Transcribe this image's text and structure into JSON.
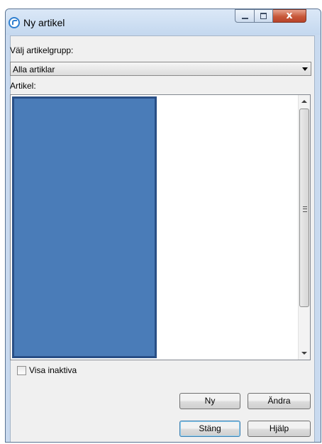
{
  "window": {
    "title": "Ny artikel",
    "icon": "app-logo-icon",
    "caption_buttons": [
      "minimize-icon",
      "maximize-icon",
      "close-icon"
    ],
    "close_glyph": "x"
  },
  "form": {
    "group_label": "Välj artikelgrupp:",
    "group_value": "Alla artiklar",
    "article_label": "Artikel:",
    "articles": [],
    "show_inactive_label": "Visa inaktiva",
    "show_inactive_checked": false
  },
  "buttons": {
    "new": "Ny",
    "edit": "Ändra",
    "close": "Stäng",
    "help": "Hjälp"
  },
  "colors": {
    "selection": "#4a7cb8",
    "close_button": "#c75839"
  }
}
